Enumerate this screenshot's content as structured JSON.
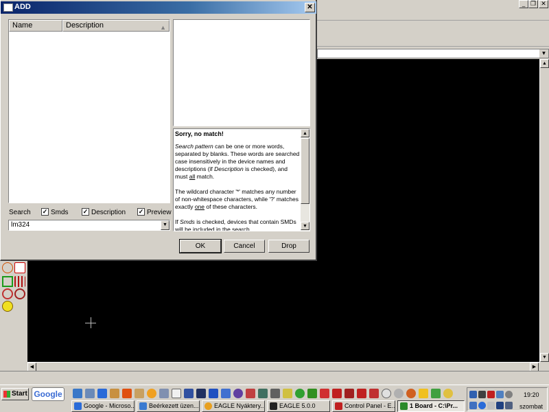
{
  "background_window": {
    "min_symbol": "_",
    "restore_symbol": "❐",
    "close_symbol": "✕"
  },
  "dialog": {
    "title": "ADD",
    "close_symbol": "✕",
    "list": {
      "columns": [
        "Name",
        "Description"
      ],
      "sort_icon": "▲"
    },
    "description": {
      "heading": "Sorry, no match!",
      "p1_em": "Search pattern",
      "p1_a": " can be one or more words, separated by blanks. These words are searched case insensitively in the device names and descriptions (if ",
      "p1_em2": "Description",
      "p1_b": " is checked), and must ",
      "p1_u": "all",
      "p1_c": " match.",
      "p2_a": "The wildcard character '*' matches any number of non-whitespace characters, while '?' matches exactly ",
      "p2_u": "one",
      "p2_b": " of these characters.",
      "p3_a": "If ",
      "p3_em": "Smds",
      "p3_b": " is checked, devices that contain SMDs will be included in the search."
    },
    "options": {
      "search_label": "Search",
      "smds_label": "Smds",
      "smds_checked": "✓",
      "description_label": "Description",
      "description_checked": "✓",
      "preview_label": "Preview",
      "preview_checked": "✓"
    },
    "search_value": "lm324",
    "combo_arrow": "▼",
    "buttons": {
      "ok": "OK",
      "cancel": "Cancel",
      "drop": "Drop"
    }
  },
  "taskbar": {
    "start_label": "Start",
    "google_label": "Google",
    "tasks": [
      {
        "label": "Google - Microso...",
        "color": "#2a6bd8"
      },
      {
        "label": "Beérkezett üzen...",
        "color": "#3a7ad0"
      },
      {
        "label": "EAGLE Nyáktery...",
        "color": "#e8a020"
      },
      {
        "label": "EAGLE 5.0.0",
        "color": "#222222"
      },
      {
        "label": "Control Panel - E...",
        "color": "#c02020"
      },
      {
        "label": "1 Board - C:\\Pr...",
        "color": "#2a8a2a"
      }
    ],
    "clock_time": "19:20",
    "clock_day": "szombat"
  },
  "colors": {
    "canvas": "#000000",
    "title_gradient_start": "#0a246a",
    "face": "#d4d0c8"
  }
}
